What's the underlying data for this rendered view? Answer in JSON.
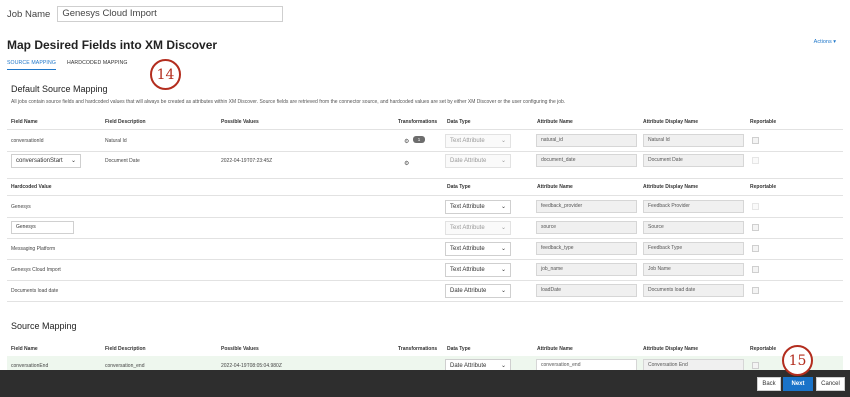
{
  "job": {
    "label": "Job Name",
    "value": "Genesys Cloud Import"
  },
  "title": "Map Desired Fields into XM Discover",
  "actions": "Actions ▾",
  "tabs": [
    {
      "label": "SOURCE MAPPING",
      "active": true
    },
    {
      "label": "HARDCODED MAPPING",
      "active": false
    }
  ],
  "callouts": {
    "first": "14",
    "second": "15"
  },
  "default_section": {
    "title": "Default Source Mapping",
    "description": "All jobs contain source fields and hardcoded values that will always be created as attributes within XM Discover. Source fields are retrieved from the connector source, and hardcoded values are set by either XM Discover or the user configuring the job.",
    "headers": {
      "field_name": "Field Name",
      "field_description": "Field Description",
      "possible_values": "Possible Values",
      "transformations": "Transformations",
      "data_type": "Data Type",
      "attribute_name": "Attribute Name",
      "attribute_display_name": "Attribute Display Name",
      "reportable": "Reportable"
    },
    "rows": [
      {
        "field_name": "conversationId",
        "description": "Natural Id",
        "possible_values": "",
        "badge": "1",
        "data_type": "Text Attribute",
        "attribute_name": "natural_id",
        "display_name": "Natural Id"
      },
      {
        "field_name": "conversationStart",
        "description": "Document Date",
        "possible_values": "2022-04-19T07:23:45Z",
        "data_type": "Date Attribute",
        "attribute_name": "document_date",
        "display_name": "Document Date"
      }
    ]
  },
  "hardcoded": {
    "headers": {
      "value": "Hardcoded Value",
      "data_type": "Data Type",
      "attribute_name": "Attribute Name",
      "attribute_display_name": "Attribute Display Name",
      "reportable": "Reportable"
    },
    "rows": [
      {
        "value": "Genesys",
        "data_type": "Text Attribute",
        "attribute_name": "feedback_provider",
        "display_name": "Feedback Provider"
      },
      {
        "value": "Genesys",
        "data_type": "Text Attribute",
        "attribute_name": "source",
        "display_name": "Source"
      },
      {
        "value": "Messaging Platform",
        "data_type": "Text Attribute",
        "attribute_name": "feedback_type",
        "display_name": "Feedback Type"
      },
      {
        "value": "Genesys Cloud Import",
        "data_type": "Text Attribute",
        "attribute_name": "job_name",
        "display_name": "Job Name"
      },
      {
        "value": "Documents load date",
        "data_type": "Date Attribute",
        "attribute_name": "loadDate",
        "display_name": "Documents load date"
      }
    ]
  },
  "source_section": {
    "title": "Source Mapping",
    "headers": {
      "field_name": "Field Name",
      "field_description": "Field Description",
      "possible_values": "Possible Values",
      "transformations": "Transformations",
      "data_type": "Data Type",
      "attribute_name": "Attribute Name",
      "attribute_display_name": "Attribute Display Name",
      "reportable": "Reportable"
    },
    "rows": [
      {
        "field_name": "conversationEnd",
        "description": "conversation_end",
        "possible_values": "2022-04-19T08:05:04.980Z",
        "data_type": "Date Attribute",
        "attribute_name": "conversation_end",
        "display_name": "Conversation End"
      }
    ]
  },
  "footer": {
    "back": "Back",
    "next": "Next",
    "cancel": "Cancel"
  },
  "icons": {
    "gear": "gear-icon",
    "chevron": "chevron-down-icon"
  },
  "colors": {
    "accent": "#1a73c9",
    "callout": "#b32d1e",
    "footer": "#2e2e2e"
  }
}
